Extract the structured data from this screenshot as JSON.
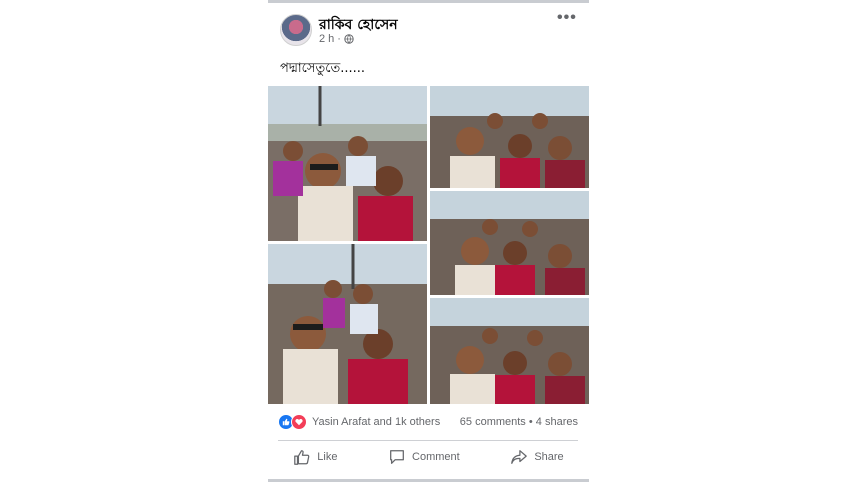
{
  "post": {
    "author": "রাকিব হোসেন",
    "time": "2 h",
    "privacy_icon": "globe-icon",
    "caption": "পদ্মাসেতুতে......",
    "more_label": "•••"
  },
  "photos": [
    {
      "name": "group-selfie-1"
    },
    {
      "name": "group-selfie-2"
    },
    {
      "name": "group-selfie-3"
    },
    {
      "name": "group-selfie-4"
    },
    {
      "name": "group-selfie-5"
    }
  ],
  "engagement": {
    "reactions_text": "Yasin Arafat and 1k others",
    "comments": "65 comments",
    "separator": "•",
    "shares": "4 shares",
    "reaction_icons": [
      "like-icon",
      "love-icon"
    ]
  },
  "actions": {
    "like": "Like",
    "comment": "Comment",
    "share": "Share"
  },
  "colors": {
    "like_blue": "#1877f2",
    "love_red": "#f33e58",
    "meta_gray": "#65676b"
  }
}
